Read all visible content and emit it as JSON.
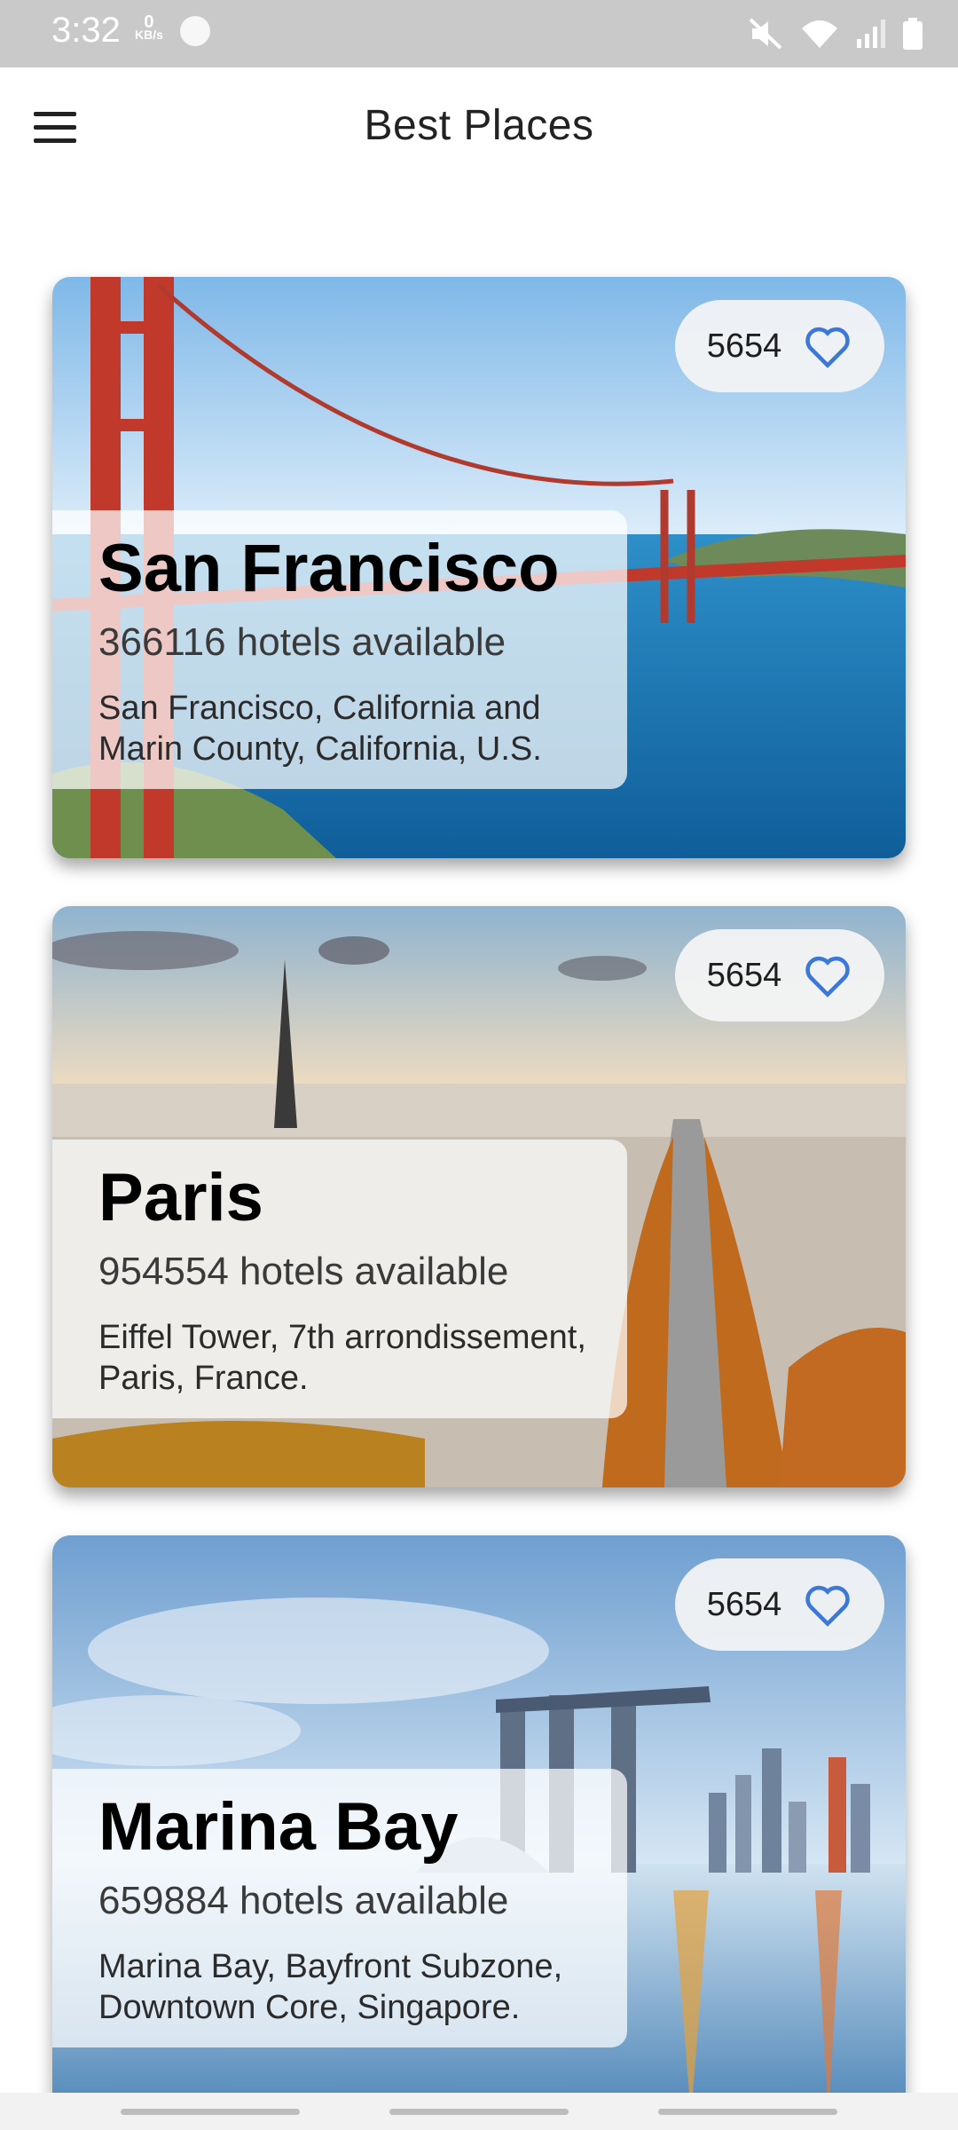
{
  "status_bar": {
    "time": "3:32",
    "net_speed_value": "0",
    "net_speed_unit": "KB/s",
    "icons": [
      "sync-icon",
      "mute-icon",
      "wifi-icon",
      "signal-icon",
      "battery-icon"
    ]
  },
  "app_bar": {
    "title": "Best Places",
    "menu_icon": "hamburger-menu-icon"
  },
  "places": [
    {
      "name": "San Francisco",
      "hotels": "366116 hotels available",
      "address": " San Francisco, California and Marin County, California, U.S.",
      "likes": "5654",
      "like_icon": "heart-outline-icon"
    },
    {
      "name": "Paris",
      "hotels": "954554 hotels available",
      "address": "Eiffel Tower, 7th arrondissement, Paris, France.",
      "likes": "5654",
      "like_icon": "heart-outline-icon"
    },
    {
      "name": "Marina Bay",
      "hotels": "659884 hotels available",
      "address": "Marina Bay,  Bayfront Subzone, Downtown Core, Singapore.",
      "likes": "5654",
      "like_icon": "heart-outline-icon"
    }
  ],
  "colors": {
    "accent": "#3b78d8",
    "status_bar": "#c9c9c9"
  }
}
